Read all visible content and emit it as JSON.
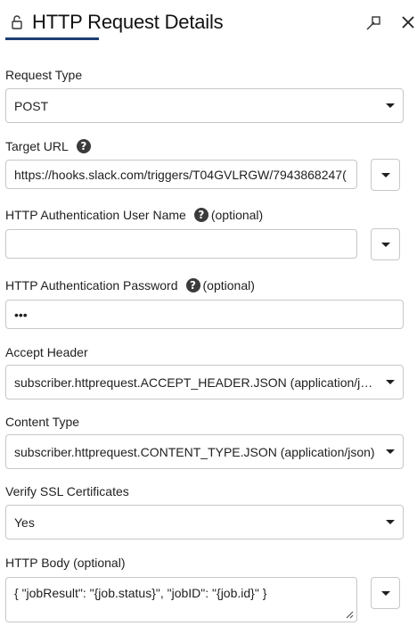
{
  "header": {
    "title": "HTTP Request Details",
    "icons": {
      "lock": "unlock-icon",
      "popout": "popout-icon",
      "close": "close-icon"
    }
  },
  "optional_text": "(optional)",
  "help_glyph": "?",
  "fields": {
    "request_type": {
      "label": "Request Type",
      "value": "POST"
    },
    "target_url": {
      "label": "Target URL",
      "value": "https://hooks.slack.com/triggers/T04GVLRGW/7943868247("
    },
    "auth_user": {
      "label": "HTTP Authentication User Name",
      "value": ""
    },
    "auth_password": {
      "label": "HTTP Authentication Password",
      "value": "•••"
    },
    "accept_header": {
      "label": "Accept Header",
      "value": "subscriber.httprequest.ACCEPT_HEADER.JSON (application/json)"
    },
    "content_type": {
      "label": "Content Type",
      "value": "subscriber.httprequest.CONTENT_TYPE.JSON (application/json)"
    },
    "verify_ssl": {
      "label": "Verify SSL Certificates",
      "value": "Yes"
    },
    "http_body": {
      "label": "HTTP Body",
      "value": "{ \"jobResult\": \"{job.status}\", \"jobID\": \"{job.id}\" }"
    }
  }
}
